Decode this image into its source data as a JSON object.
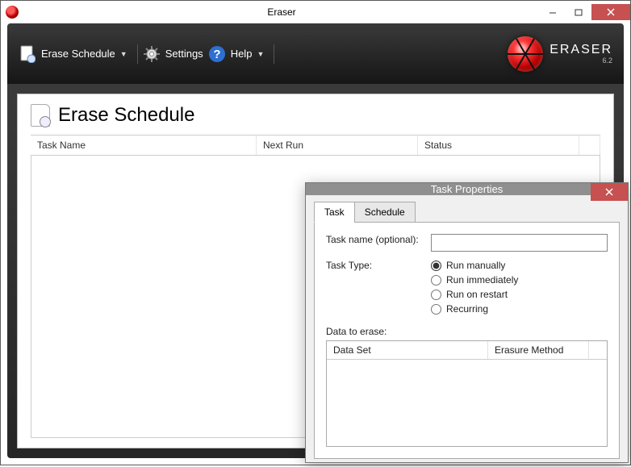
{
  "window": {
    "title": "Eraser"
  },
  "brand": {
    "name": "ERASER",
    "version": "6.2"
  },
  "ribbon": {
    "erase_schedule": "Erase Schedule",
    "settings": "Settings",
    "help": "Help"
  },
  "page": {
    "title": "Erase Schedule"
  },
  "grid": {
    "columns": {
      "task_name": "Task Name",
      "next_run": "Next Run",
      "status": "Status"
    },
    "rows": []
  },
  "dialog": {
    "title": "Task Properties",
    "tabs": {
      "task": "Task",
      "schedule": "Schedule"
    },
    "task_name_label": "Task name (optional):",
    "task_name_value": "",
    "task_type_label": "Task Type:",
    "task_type_options": {
      "manual": "Run manually",
      "immediate": "Run immediately",
      "restart": "Run on restart",
      "recurring": "Recurring"
    },
    "task_type_selected": "manual",
    "data_to_erase_label": "Data to erase:",
    "data_columns": {
      "data_set": "Data Set",
      "erasure_method": "Erasure Method"
    },
    "data_rows": []
  }
}
